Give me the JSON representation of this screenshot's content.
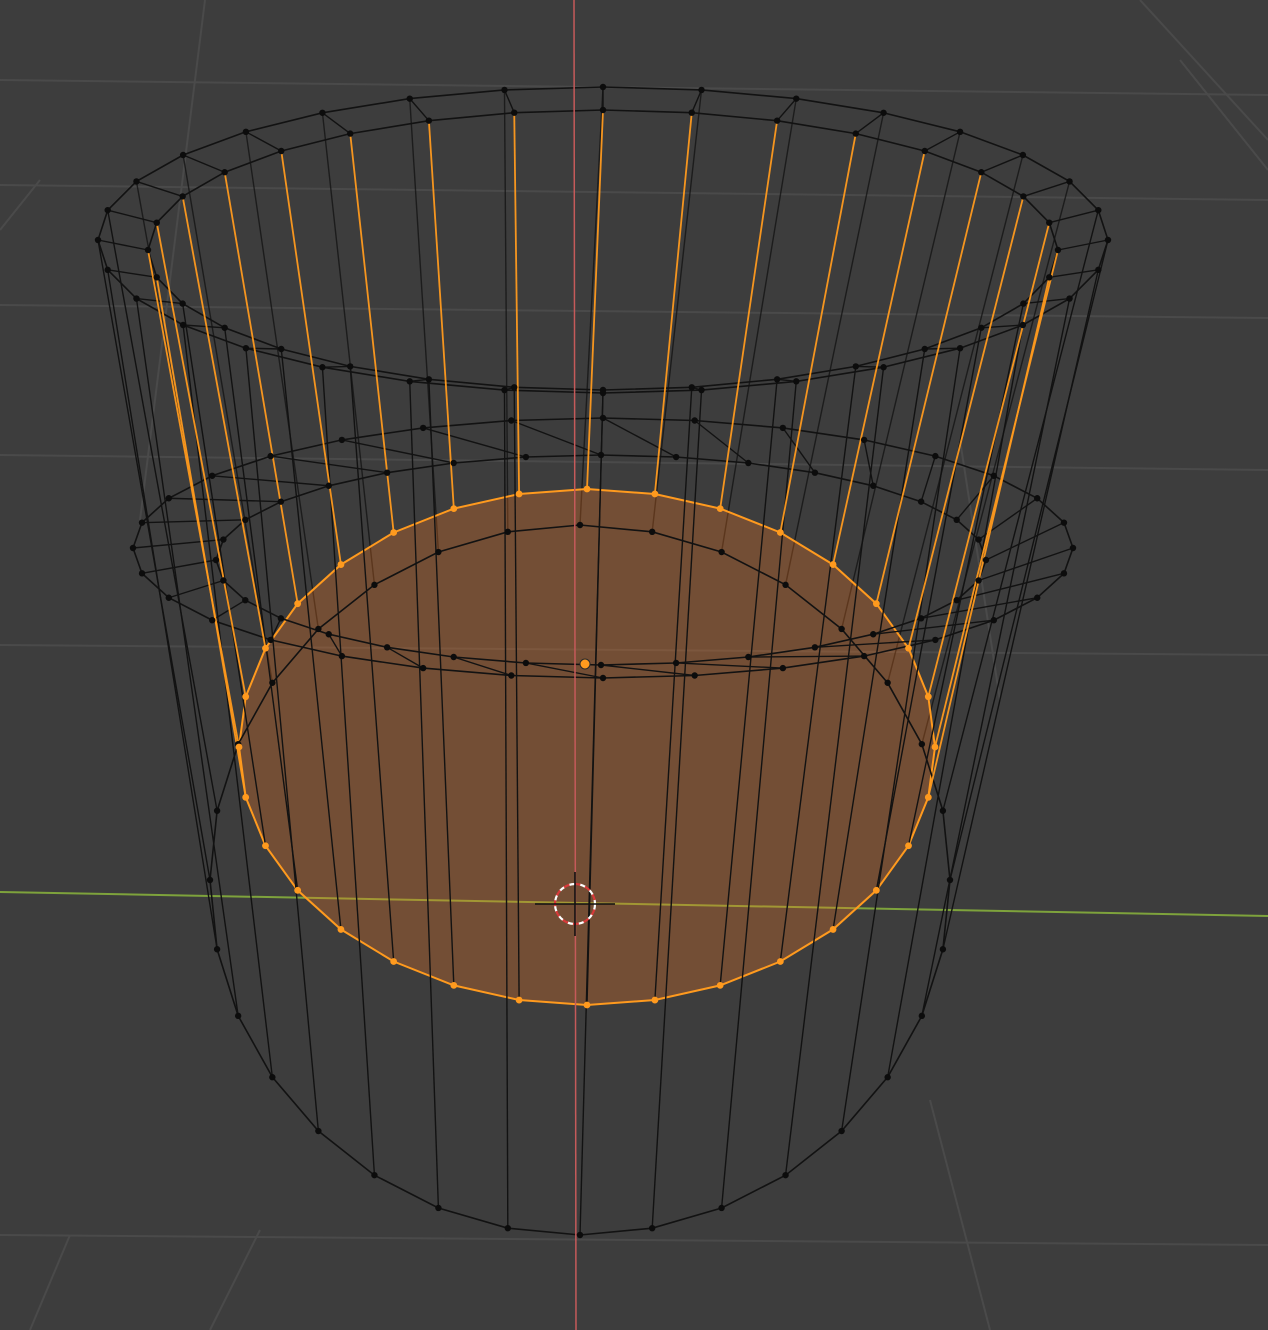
{
  "viewport": {
    "background": "#3d3d3d",
    "grid_color": "#4a4a4a",
    "x_axis_color": "#7ea33c",
    "y_axis_color": "#c55a5a",
    "mesh": {
      "object": "cylinder",
      "segments": 32,
      "edge_color": "#121212",
      "vertex_color": "#0c0c0c",
      "selected_color": "#ff9a1e",
      "selected_face_fill": "#ff7b22",
      "selected_region": "inner-bottom-disc-and-inner-wall-edges"
    },
    "overlays": {
      "cursor_3d": "3d-cursor-icon",
      "origin": "object-origin-icon"
    }
  }
}
